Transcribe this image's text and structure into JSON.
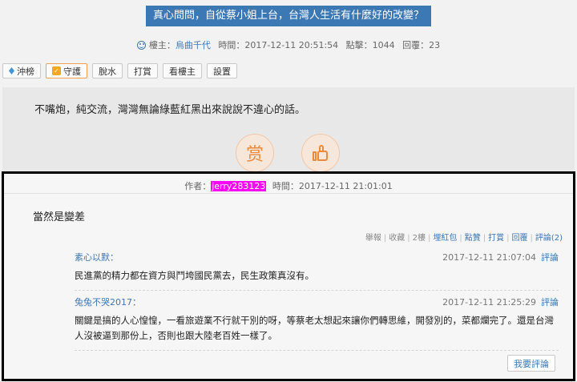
{
  "post": {
    "title": "真心問問，自從蔡小姐上台，台灣人生活有什麼好的改變？",
    "meta": {
      "author_label": "樓主：",
      "author": "烏曲千代",
      "time_label": "時間：",
      "time": "2017-12-11 20:51:54",
      "clicks_label": "點擊：",
      "clicks": "1044",
      "replies_label": "回覆：",
      "replies": "23"
    },
    "toolbar": [
      "沖榜",
      "守護",
      "脫水",
      "打賞",
      "看樓主",
      "設置"
    ],
    "body": "不嘴炮，純交流，灣灣無論綠藍紅黑出來說說不違心的話。",
    "reward_glyph": "赏"
  },
  "reply": {
    "author_label": "作者：",
    "author": "jerry283123",
    "time_label": "時間：",
    "time": "2017-12-11 21:01:01",
    "body": "當然是變差",
    "actions": {
      "report": "舉報",
      "collect": "收藏",
      "floor": "2樓",
      "red_packet": "埋紅包",
      "like": "點贊",
      "reward": "打賞",
      "reply": "回覆",
      "comment": "評論(2)"
    },
    "comments": [
      {
        "user": "素心以默：",
        "time": "2017-12-11 21:07:04",
        "reply_label": "評論",
        "text": "民進黨的精力都在資方與鬥垮國民黨去，民生政策真沒有。"
      },
      {
        "user": "兔兔不哭2017：",
        "time": "2017-12-11 21:25:29",
        "reply_label": "評論",
        "text": "關鍵是搞的人心惶惶，一看旅遊業不行就干別的呀，等蔡老太想起來讓你們轉思維，開發別的，菜都爛完了。還是台灣人沒被逼到那份上，否則也跟大陸老百姓一樣了。"
      }
    ],
    "my_comment_label": "我要評論"
  },
  "colors": {
    "title_bg": "#3c78b4",
    "accent": "#3c78b4",
    "highlight": "#ff00ff",
    "reward_orange": "#ec8a3c"
  }
}
